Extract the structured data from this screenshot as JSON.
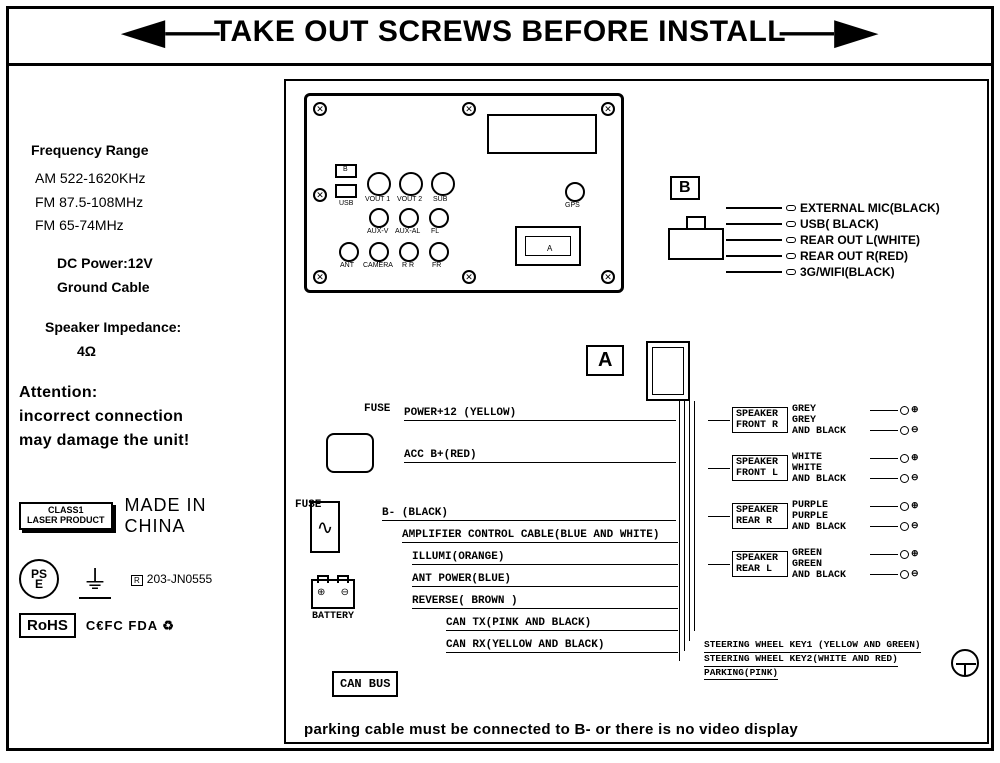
{
  "banner": "TAKE OUT SCREWS BEFORE INSTALL",
  "specs": {
    "freq_heading": "Frequency Range",
    "am": "AM 522-1620KHz",
    "fm1": "FM 87.5-108MHz",
    "fm2": "FM 65-74MHz",
    "dc": "DC Power:12V",
    "ground": "Ground Cable",
    "speaker_heading": "Speaker Impedance:",
    "impedance": "4Ω"
  },
  "attention": {
    "l1": "Attention:",
    "l2": "incorrect connection",
    "l3": "may damage the unit!"
  },
  "class1": {
    "l1": "CLASS1",
    "l2": "LASER PRODUCT"
  },
  "madein": {
    "l1": "MADE IN",
    "l2": "CHINA"
  },
  "pse": {
    "top": "PS",
    "bot": "E"
  },
  "rcode": "R",
  "rcode_num": "203-JN0555",
  "rohs": "RoHS",
  "small_certs": "C€FC FDA ♻",
  "backpanel": {
    "usb": "USB",
    "b": "B",
    "vout1": "VOUT 1",
    "vout2": "VOUT 2",
    "sub": "SUB",
    "auxv": "AUX-V",
    "auxal": "AUX-AL",
    "fl": "FL",
    "ant": "ANT",
    "camera": "CAMERA",
    "rr": "R R",
    "fr": "FR",
    "gps": "GPS",
    "a": "A"
  },
  "connB": {
    "tag": "B",
    "w1": "EXTERNAL MIC(BLACK)",
    "w2": "USB( BLACK)",
    "w3": "REAR OUT L(WHITE)",
    "w4": "REAR OUT R(RED)",
    "w5": "3G/WIFI(BLACK)"
  },
  "connA": {
    "tag": "A"
  },
  "fuse": "FUSE",
  "battery": "BATTERY",
  "canbus": "CAN BUS",
  "wires": {
    "w1": "POWER+12 (YELLOW)",
    "w2": "ACC B+(RED)",
    "w3": "B- (BLACK)",
    "w4": "AMPLIFIER CONTROL CABLE(BLUE AND WHITE)",
    "w5": "ILLUMI(ORANGE)",
    "w6": "ANT POWER(BLUE)",
    "w7": "REVERSE( BROWN )",
    "w8": "CAN TX(PINK AND BLACK)",
    "w9": "CAN RX(YELLOW AND BLACK)"
  },
  "speakers": [
    {
      "box_l1": "SPEAKER",
      "box_l2": "FRONT  R",
      "c1": "GREY",
      "c2": "GREY",
      "c3": "AND BLACK"
    },
    {
      "box_l1": "SPEAKER",
      "box_l2": "FRONT  L",
      "c1": "WHITE",
      "c2": "WHITE",
      "c3": "AND BLACK"
    },
    {
      "box_l1": "SPEAKER",
      "box_l2": "REAR   R",
      "c1": "PURPLE",
      "c2": "PURPLE",
      "c3": "AND BLACK"
    },
    {
      "box_l1": "SPEAKER",
      "box_l2": "REAR   L",
      "c1": "GREEN",
      "c2": "GREEN",
      "c3": "AND BLACK"
    }
  ],
  "swkeys": {
    "l1": "STEERING WHEEL KEY1 (YELLOW AND GREEN)",
    "l2": "STEERING  WHEEL KEY2(WHITE AND RED)",
    "l3": "PARKING(PINK)"
  },
  "plus": "⊕",
  "minus": "⊖",
  "footer": "parking cable must be connected to B- or there is no video display"
}
